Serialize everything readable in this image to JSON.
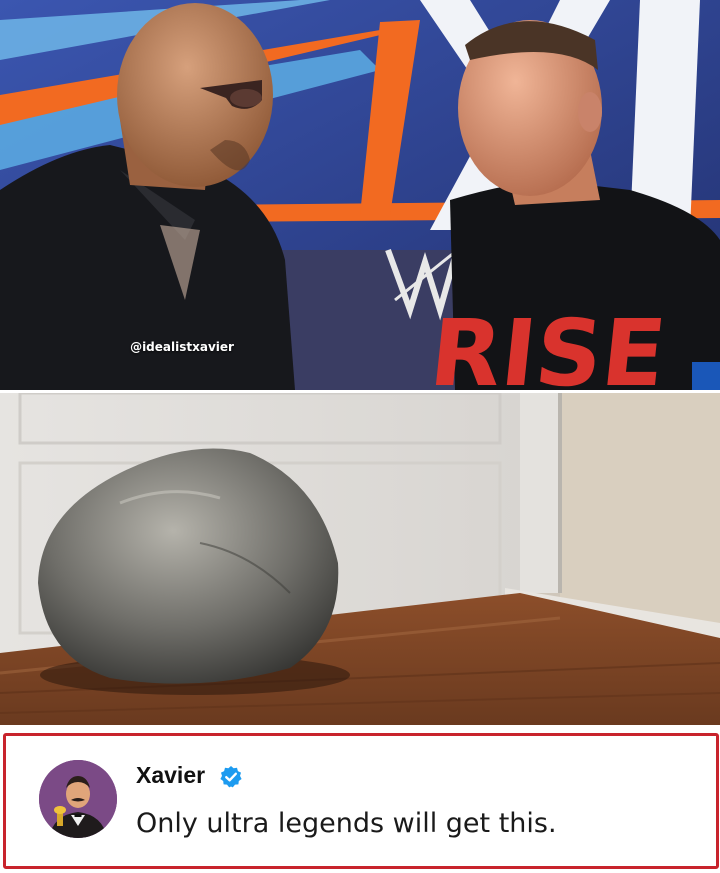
{
  "meme": {
    "watermark": "@idealistxavier",
    "comment": {
      "author": "Xavier",
      "verified": true,
      "text": "Only ultra legends will get this."
    }
  },
  "colors": {
    "frame_border": "#c8232c",
    "verified_badge": "#1d9bf0",
    "background_banner_blue": "#2d3f86",
    "banner_orange": "#f26a21"
  },
  "icons": {
    "verified": "verified-badge-icon",
    "avatar": "cartoon-avatar-icon"
  }
}
